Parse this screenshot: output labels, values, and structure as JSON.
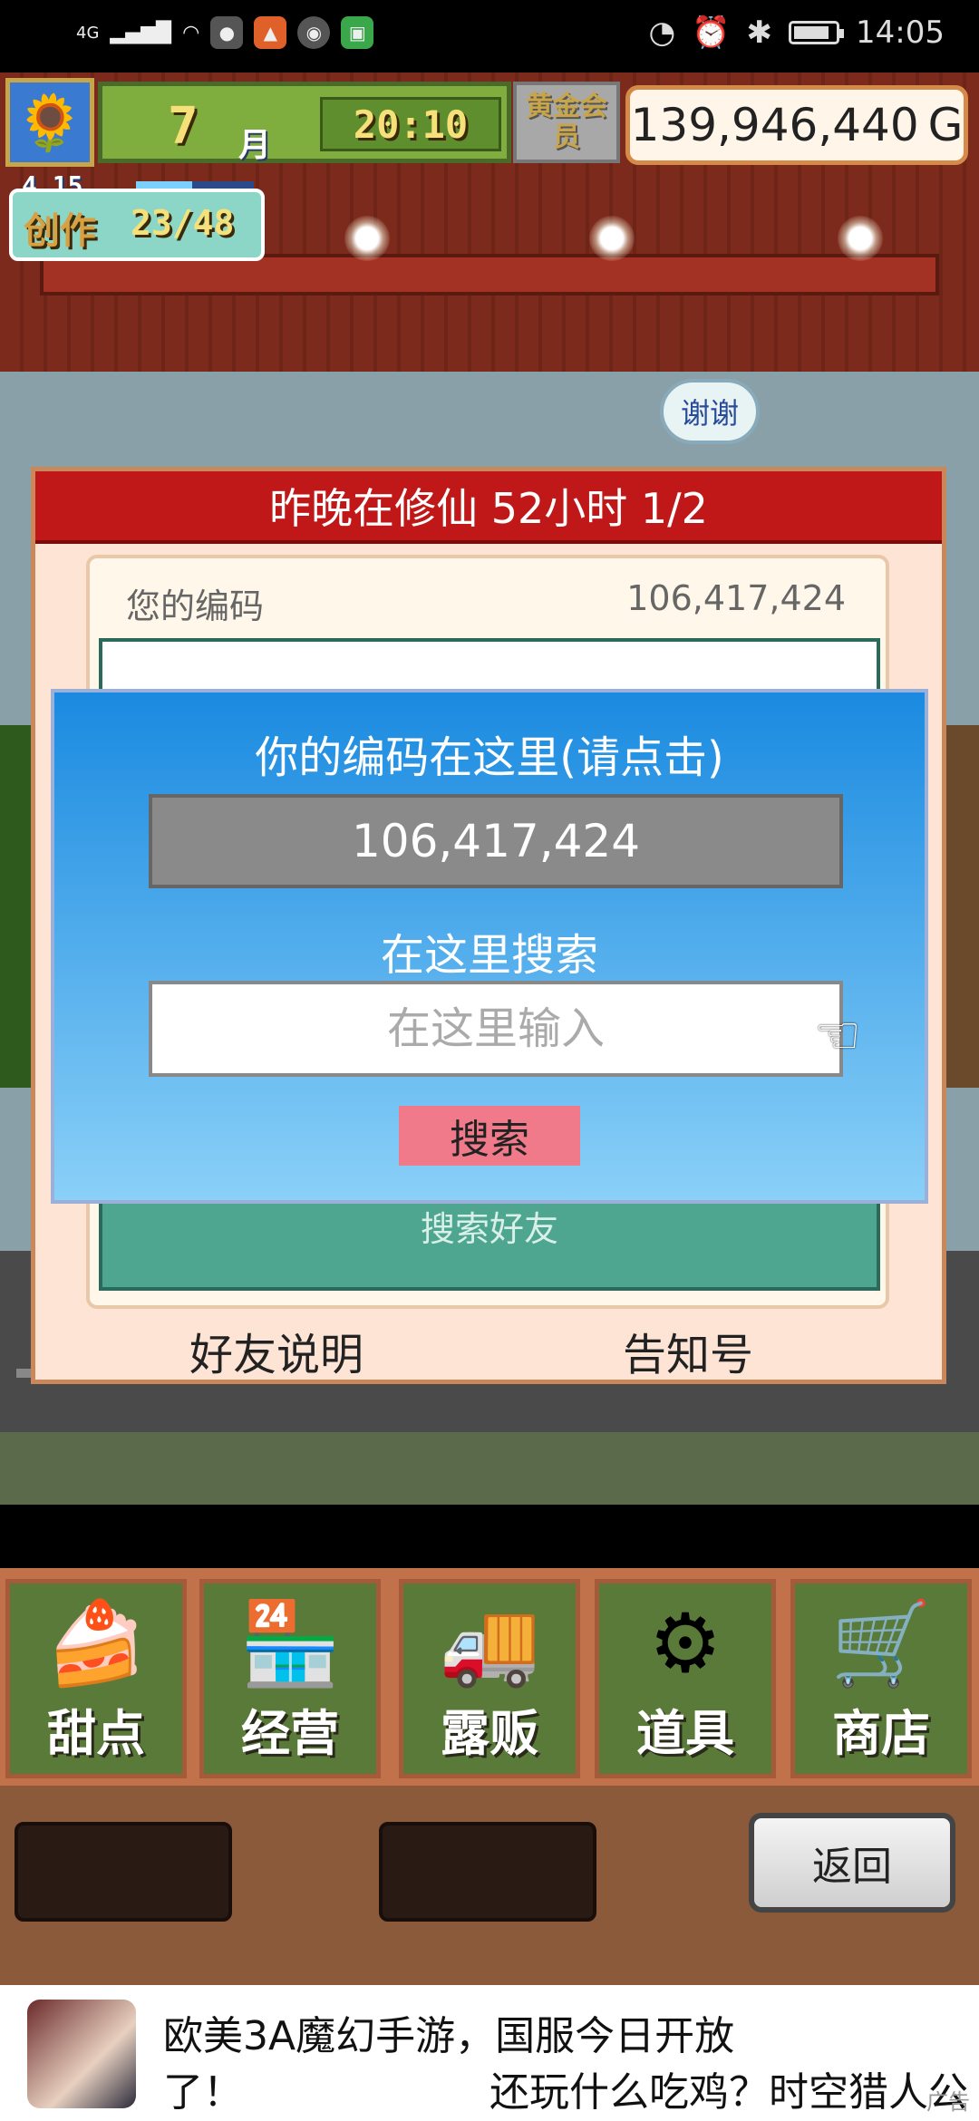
{
  "status_bar": {
    "network": "4G",
    "time": "14:05"
  },
  "hud": {
    "month": "7",
    "month_unit": "月",
    "time": "20:10",
    "membership": "黄金会员",
    "money": "139,946,440 G",
    "create_label": "创作",
    "create_sub": "4 15",
    "create_progress": "23/48",
    "create_progress_fraction": 0.48
  },
  "thanks_bubble": "谢谢",
  "panel": {
    "title": "昨晚在修仙  52小时 1/2",
    "code_label": "您的编码",
    "code_value": "106,417,424",
    "search_friend": "搜索好友",
    "friend_help": "好友说明",
    "notice": "告知号"
  },
  "overlay": {
    "title": "你的编码在这里(请点击)",
    "code": "106,417,424",
    "search_label": "在这里搜索",
    "input_placeholder": "在这里输入",
    "search_button": "搜索"
  },
  "menu": {
    "items": [
      {
        "label": "甜点",
        "icon": "cake-icon"
      },
      {
        "label": "经营",
        "icon": "shop-icon"
      },
      {
        "label": "露贩",
        "icon": "food-truck-icon"
      },
      {
        "label": "道具",
        "icon": "gear-bag-icon"
      },
      {
        "label": "商店",
        "icon": "cart-icon"
      }
    ]
  },
  "back_button": "返回",
  "ad": {
    "line1": "欧美3A魔幻手游，国服今日开放",
    "line2a": "了！",
    "line2b": "还玩什么吃鸡？时空猎人公",
    "tag": "广告"
  },
  "colors": {
    "panel_title_bg": "#c01818",
    "overlay_top": "#1a8ae0",
    "search_button": "#f07a8a",
    "menu_bg": "#5a7a3a"
  }
}
